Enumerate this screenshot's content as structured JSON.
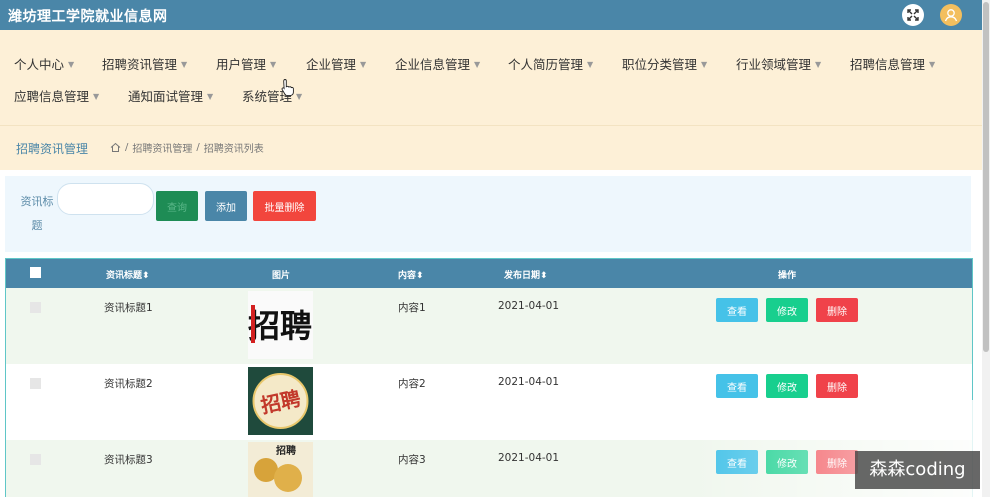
{
  "header": {
    "title": "潍坊理工学院就业信息网"
  },
  "nav": {
    "items": [
      {
        "label": "个人中心"
      },
      {
        "label": "招聘资讯管理"
      },
      {
        "label": "用户管理"
      },
      {
        "label": "企业管理"
      },
      {
        "label": "企业信息管理"
      },
      {
        "label": "个人简历管理"
      },
      {
        "label": "职位分类管理"
      },
      {
        "label": "行业领域管理"
      },
      {
        "label": "招聘信息管理"
      },
      {
        "label": "应聘信息管理"
      },
      {
        "label": "通知面试管理"
      },
      {
        "label": "系统管理"
      }
    ]
  },
  "breadcrumb": {
    "title": "招聘资讯管理",
    "path": [
      "招聘资讯管理",
      "招聘资讯列表"
    ],
    "separator": "/"
  },
  "search": {
    "label": "资讯标题",
    "value": "",
    "search_label": "查询",
    "add_label": "添加",
    "batch_delete_label": "批量删除"
  },
  "table": {
    "headers": {
      "title": "资讯标题",
      "image": "图片",
      "content": "内容",
      "date": "发布日期",
      "actions": "操作"
    },
    "sort_indicator": "⬍",
    "rows": [
      {
        "title": "资讯标题1",
        "content": "内容1",
        "date": "2021-04-01",
        "image_text": "招聘"
      },
      {
        "title": "资讯标题2",
        "content": "内容2",
        "date": "2021-04-01",
        "image_text": "招聘"
      },
      {
        "title": "资讯标题3",
        "content": "内容3",
        "date": "2021-04-01",
        "image_text": "招聘"
      }
    ],
    "actions": {
      "view": "查看",
      "edit": "修改",
      "delete": "删除"
    }
  },
  "watermark": {
    "text": "森森coding"
  },
  "colors": {
    "primary": "#4a86a8",
    "nav_bg": "#fdf0d7",
    "view": "#45c2e8",
    "edit": "#18cf8e",
    "delete": "#f0424a"
  }
}
